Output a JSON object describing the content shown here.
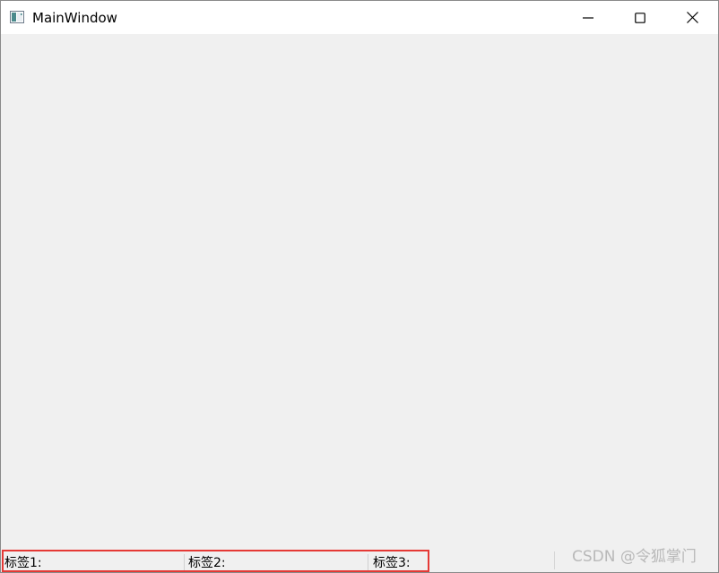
{
  "window": {
    "title": "MainWindow"
  },
  "caption_buttons": {
    "minimize": "minimize-icon",
    "maximize": "maximize-icon",
    "close": "close-icon"
  },
  "statusbar": {
    "labels": [
      "标签1:",
      "标签2:",
      "标签3:"
    ]
  },
  "watermark": {
    "text": "CSDN @令狐掌门"
  },
  "colors": {
    "client_bg": "#f0f0f0",
    "titlebar_bg": "#ffffff",
    "highlight": "#e53935"
  }
}
